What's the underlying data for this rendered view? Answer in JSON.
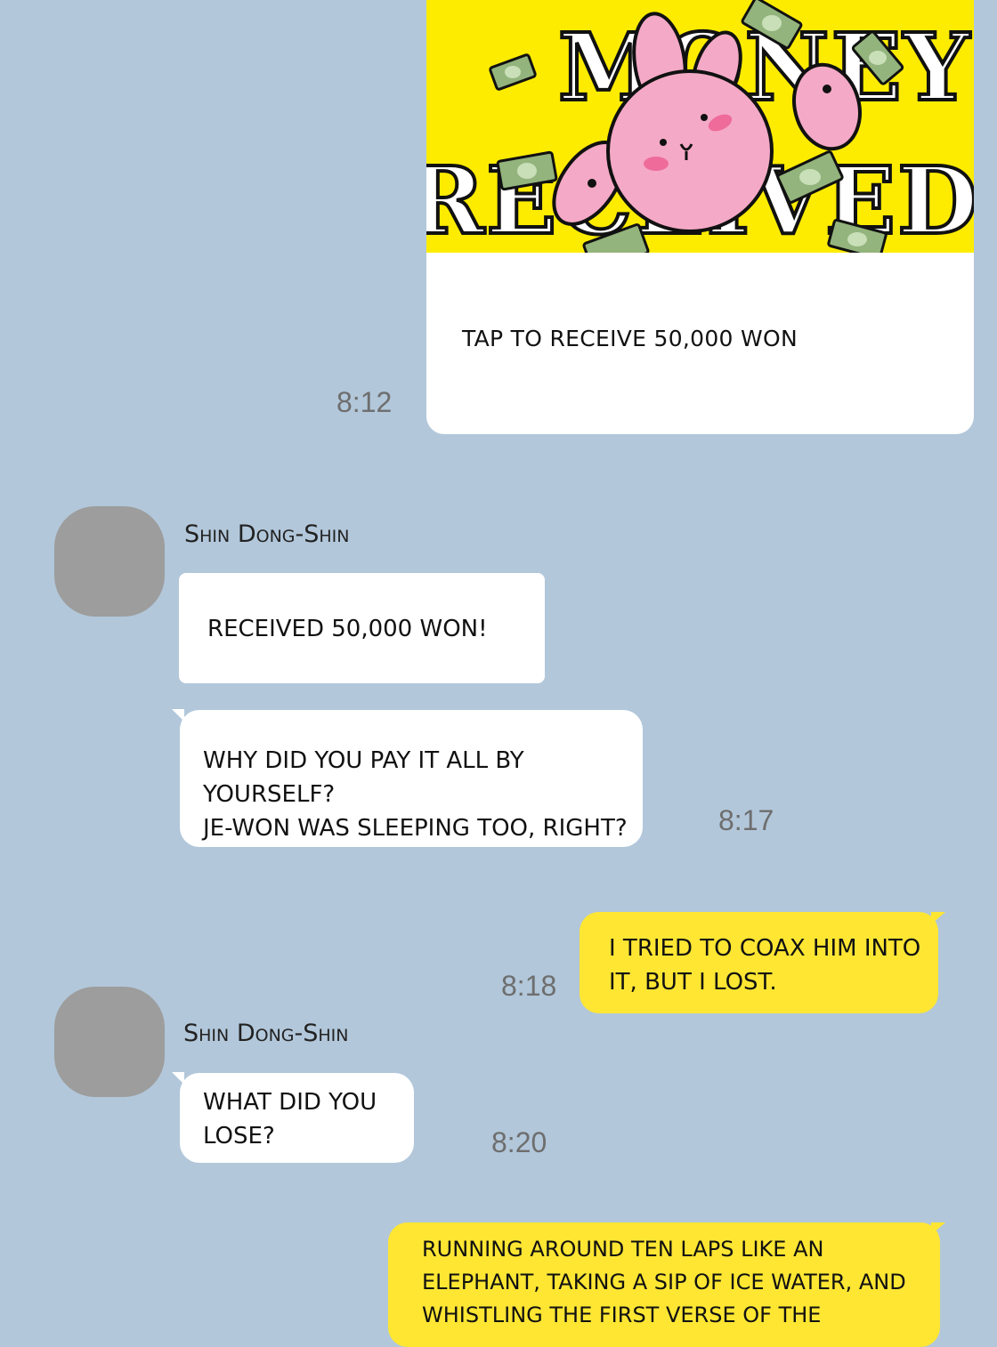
{
  "money_card": {
    "banner_text": "MONEY RECEIVED",
    "caption": "TAP TO RECEIVE 50,000 WON",
    "time": "8:12"
  },
  "messages": [
    {
      "sender": "Shin Dong-Shin",
      "text": "RECEIVED 50,000 WON!"
    },
    {
      "text": "WHY DID YOU PAY IT ALL BY YOURSELF?\nJE-WON WAS SLEEPING TOO, RIGHT?",
      "time": "8:17"
    },
    {
      "text": "I TRIED TO COAX HIM INTO\nIT, BUT I LOST.",
      "time": "8:18"
    },
    {
      "sender": "Shin Dong-Shin",
      "text": "WHAT DID YOU\nLOSE?",
      "time": "8:20"
    },
    {
      "text": "RUNNING AROUND TEN LAPS LIKE AN\nELEPHANT, TAKING A SIP OF ICE WATER, AND\nWHISTLING THE FIRST VERSE OF THE"
    }
  ],
  "colors": {
    "background": "#b2c7da",
    "my_bubble": "#fee633",
    "their_bubble": "#ffffff",
    "banner": "#fdec00",
    "avatar": "#9d9d9d"
  },
  "icons": [
    "avatar-placeholder",
    "bunny-sticker",
    "cash-bill"
  ]
}
